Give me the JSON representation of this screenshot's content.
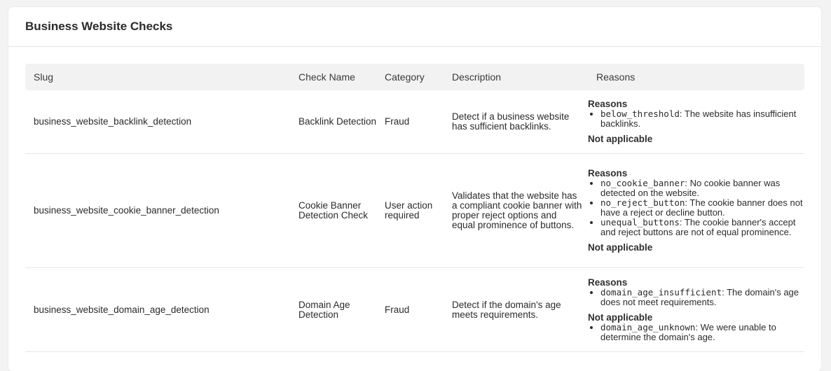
{
  "card": {
    "title": "Business Website Checks"
  },
  "table": {
    "headers": [
      "Slug",
      "Check Name",
      "Category",
      "Description",
      "Reasons"
    ],
    "rows": [
      {
        "slug": "business_website_backlink_detection",
        "name": "Backlink Detection",
        "category": "Fraud",
        "description": "Detect if a business website has sufficient backlinks.",
        "reasons_title": "Reasons",
        "reasons": [
          {
            "code": "below_threshold",
            "text": ": The website has insufficient backlinks."
          }
        ],
        "na_title": "Not applicable",
        "na": []
      },
      {
        "slug": "business_website_cookie_banner_detection",
        "name": "Cookie Banner Detection Check",
        "category": "User action required",
        "description": "Validates that the website has a compliant cookie banner with proper reject options and equal prominence of buttons.",
        "reasons_title": "Reasons",
        "reasons": [
          {
            "code": "no_cookie_banner",
            "text": ": No cookie banner was detected on the website."
          },
          {
            "code": "no_reject_button",
            "text": ": The cookie banner does not have a reject or decline button."
          },
          {
            "code": "unequal_buttons",
            "text": ": The cookie banner's accept and reject buttons are not of equal prominence."
          }
        ],
        "na_title": "Not applicable",
        "na": []
      },
      {
        "slug": "business_website_domain_age_detection",
        "name": "Domain Age Detection",
        "category": "Fraud",
        "description": "Detect if the domain's age meets requirements.",
        "reasons_title": "Reasons",
        "reasons": [
          {
            "code": "domain_age_insufficient",
            "text": ": The domain's age does not meet requirements."
          }
        ],
        "na_title": "Not applicable",
        "na": [
          {
            "code": "domain_age_unknown",
            "text": ": We were unable to determine the domain's age."
          }
        ]
      }
    ]
  }
}
